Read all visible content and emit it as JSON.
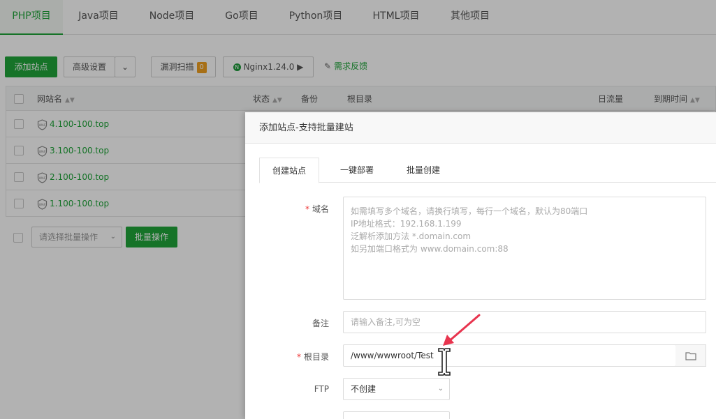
{
  "tabs": [
    {
      "label": "PHP项目",
      "active": true
    },
    {
      "label": "Java项目"
    },
    {
      "label": "Node项目"
    },
    {
      "label": "Go项目"
    },
    {
      "label": "Python项目"
    },
    {
      "label": "HTML项目"
    },
    {
      "label": "其他项目"
    }
  ],
  "toolbar": {
    "add_site": "添加站点",
    "advanced": "高级设置",
    "vuln_scan": "漏洞扫描",
    "vuln_count": "0",
    "nginx": "Nginx1.24.0 ▶",
    "feedback": "需求反馈"
  },
  "table": {
    "headers": {
      "name": "网站名",
      "status": "状态",
      "backup": "备份",
      "root": "根目录",
      "traffic": "日流量",
      "expire": "到期时间"
    },
    "rows": [
      "4.100-100.top",
      "3.100-100.top",
      "2.100-100.top",
      "1.100-100.top"
    ]
  },
  "batch": {
    "placeholder": "请选择批量操作",
    "button": "批量操作"
  },
  "modal": {
    "title": "添加站点-支持批量建站",
    "tabs": [
      "创建站点",
      "一键部署",
      "批量创建"
    ],
    "domain_label": "域名",
    "domain_placeholder_lines": [
      "如需填写多个域名，请换行填写，每行一个域名，默认为80端口",
      "IP地址格式：192.168.1.199",
      "泛解析添加方法 *.domain.com",
      "如另加端口格式为 www.domain.com:88"
    ],
    "note_label": "备注",
    "note_placeholder": "请输入备注,可为空",
    "root_label": "根目录",
    "root_value": "/www/wwwroot/Test",
    "ftp_label": "FTP",
    "ftp_value": "不创建"
  },
  "colors": {
    "accent": "#20a53a",
    "required": "#e33333",
    "arrow": "#e8344e"
  },
  "icons": [
    "shield-icon",
    "sort-icon",
    "folder-icon",
    "chevron-down-icon",
    "feedback-icon",
    "nginx-icon"
  ]
}
